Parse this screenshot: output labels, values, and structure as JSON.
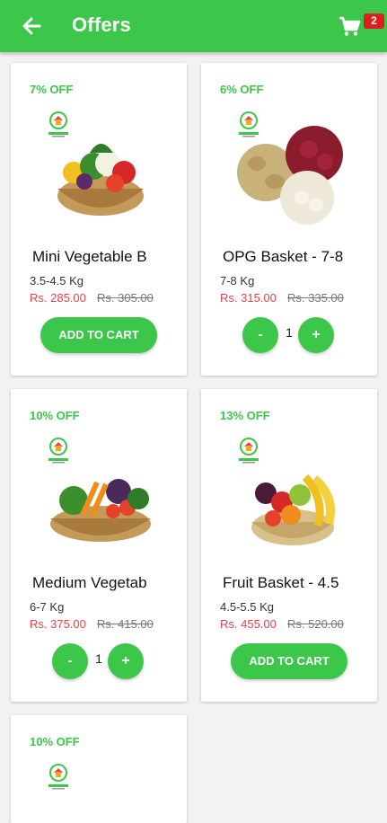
{
  "appbar": {
    "title": "Offers",
    "back_icon": "arrow-left-icon",
    "cart_icon": "shopping-cart-icon",
    "cart_count": "2",
    "background": "#3cc64a"
  },
  "currency_note": "Rs.",
  "products": [
    {
      "discount": "7% OFF",
      "name": "Mini Vegetable B",
      "weight": "3.5-4.5 Kg",
      "price": "Rs. 285.00",
      "old_price": "Rs. 305.00",
      "action": "ADD TO CART"
    },
    {
      "discount": "6% OFF",
      "name": "OPG Basket - 7-8",
      "weight": "7-8 Kg",
      "price": "Rs. 315.00",
      "old_price": "Rs. 335.00",
      "qty_minus": "-",
      "qty": "1",
      "qty_plus": "+"
    },
    {
      "discount": "10% OFF",
      "name": "Medium Vegetab",
      "weight": "6-7 Kg",
      "price": "Rs. 375.00",
      "old_price": "Rs. 415.00",
      "qty_minus": "-",
      "qty": "1",
      "qty_plus": "+"
    },
    {
      "discount": "13% OFF",
      "name": "Fruit Basket - 4.5",
      "weight": "4.5-5.5 Kg",
      "price": "Rs. 455.00",
      "old_price": "Rs. 520.00",
      "action": "ADD TO CART"
    },
    {
      "discount": "10% OFF"
    }
  ],
  "colors": {
    "accent": "#3cc64a",
    "price": "#e8414d",
    "badge": "#e21d1d"
  }
}
